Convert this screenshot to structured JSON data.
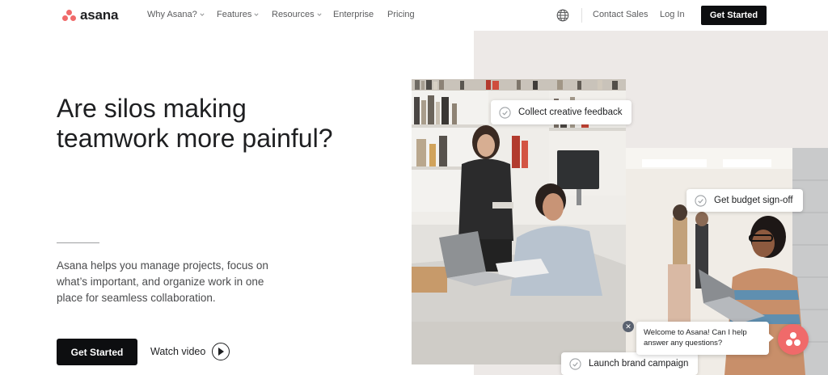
{
  "nav": {
    "logo_text": "asana",
    "items": [
      {
        "label": "Why Asana?",
        "dropdown": true
      },
      {
        "label": "Features",
        "dropdown": true
      },
      {
        "label": "Resources",
        "dropdown": true
      },
      {
        "label": "Enterprise",
        "dropdown": false
      },
      {
        "label": "Pricing",
        "dropdown": false
      }
    ],
    "language_icon": "globe-icon",
    "contact_label": "Contact Sales",
    "login_label": "Log In",
    "cta_label": "Get Started"
  },
  "hero": {
    "headline": "Are silos making teamwork more painful?",
    "body": "Asana helps you manage projects, focus on what’s important, and organize work in one place for seamless collaboration.",
    "cta_label": "Get Started",
    "video_label": "Watch video"
  },
  "chips": {
    "feedback": "Collect creative feedback",
    "budget": "Get budget sign-off",
    "launch": "Launch brand campaign"
  },
  "chat": {
    "message": "Welcome to Asana! Can I help answer any questions?",
    "close_icon": "close-icon"
  },
  "colors": {
    "brand_coral": "#f06a6a",
    "button_dark": "#0d0e10",
    "panel_bg": "#ede9e7"
  }
}
